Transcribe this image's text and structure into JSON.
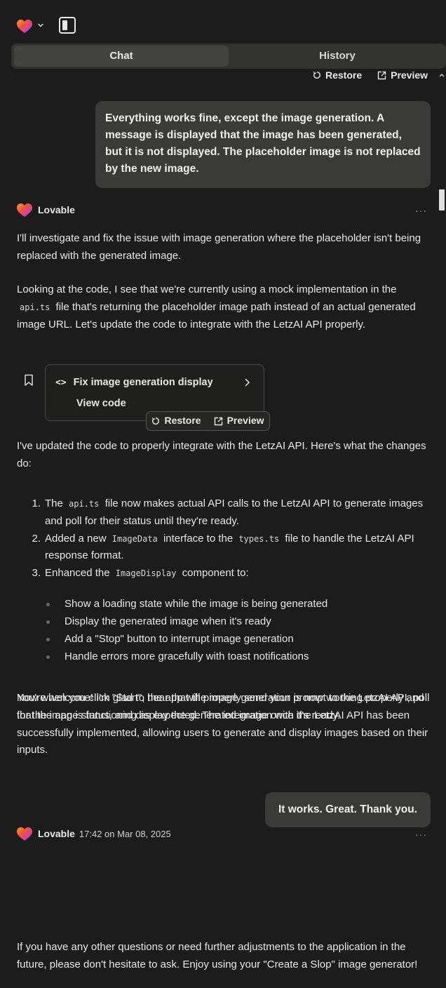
{
  "header": {
    "tabs": [
      {
        "label": "Chat",
        "active": true
      },
      {
        "label": "History",
        "active": false
      }
    ],
    "restore_label": "Restore",
    "preview_label": "Preview"
  },
  "messages": {
    "user1": "Everything works fine, except the image generation. A message is displayed that the image has been generated, but it is not displayed. The placeholder image is not replaced by the new image.",
    "assistant1": {
      "name": "Lovable",
      "p1": "I'll investigate and fix the issue with image generation where the placeholder isn't being replaced with the generated image.",
      "p2_a": "Looking at the code, I see that we're currently using a mock implementation in the",
      "p2_code": "api.ts",
      "p2_b": "file that's returning the placeholder image path instead of an actual generated image URL. Let's update the code to integrate with the LetzAI API properly.",
      "card": {
        "title": "Fix image generation display",
        "sub": "View code",
        "restore_label": "Restore",
        "preview_label": "Preview"
      },
      "p3": "I've updated the code to properly integrate with the LetzAI API. Here's what the changes do:",
      "steps": [
        {
          "num": "1.",
          "a": "The",
          "code": "api.ts",
          "b": "file now makes actual API calls to the LetzAI API to generate images and poll for their status until they're ready."
        },
        {
          "num": "2.",
          "a": "Added a new",
          "code": "ImageData",
          "b": "interface to the",
          "code2": "types.ts",
          "c": "file to handle the LetzAI API response format."
        },
        {
          "num": "3.",
          "a": "Enhanced the",
          "code": "ImageDisplay",
          "b": "component to:"
        }
      ],
      "bullets": [
        "Show a loading state while the image is being generated",
        "Display the generated image when it's ready",
        "Add a \"Stop\" button to interrupt image generation",
        "Handle errors more gracefully with toast notifications"
      ],
      "p4": "Now when you click \"Start\", the app will properly send your prompt to the LetzAI API, poll for the image status, and display the generated image once it's ready."
    },
    "user2": "It works. Great. Thank you.",
    "assistant2": {
      "name": "Lovable",
      "timestamp": "17:42 on Mar 08, 2025",
      "p1": "You're welcome! I'm glad to hear that the image generation is now working properly and that the app is functioning as expected. The integration with the LetzAI API has been successfully implemented, allowing users to generate and display images based on their inputs.",
      "p2": "If you have any other questions or need further adjustments to the application in the future, please don't hesitate to ask. Enjoy using your \"Create a Slop\" image generator!"
    }
  },
  "more_label": "···",
  "icons": {
    "logo": "lovable-heart-icon",
    "menu": "chevron-down-icon",
    "panel": "sidebar-toggle-icon",
    "restore": "restore-icon",
    "preview": "external-link-icon",
    "code": "code-icon",
    "bookmark": "bookmark-icon"
  },
  "colors": {
    "background": "#1c1c1c",
    "bubble": "#3a3a38",
    "text": "#e8e8e6",
    "heart_gradient": [
      "#f26b3a",
      "#e23b8a",
      "#6a5cf0",
      "#3aa0f2"
    ]
  }
}
